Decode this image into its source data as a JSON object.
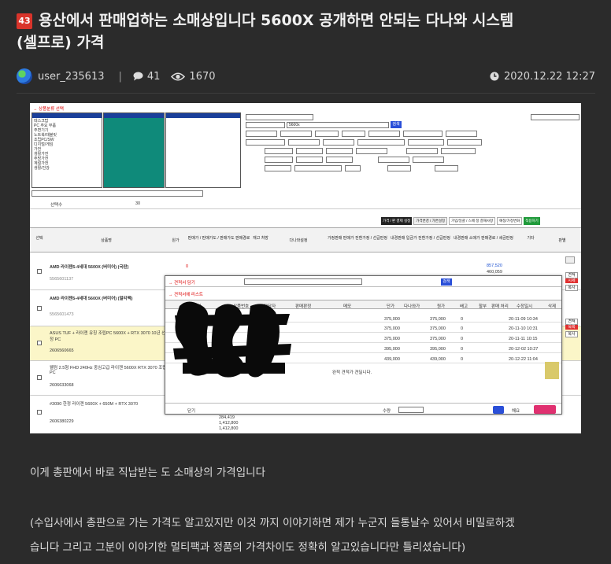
{
  "post": {
    "badge": "43",
    "title_line1": "용산에서 판매업하는 소매상입니다 5600X 공개하면 안되는 다나와 시스템",
    "title_line2": "(셀프로) 가격",
    "author": "user_235613",
    "comments": "41",
    "views": "1670",
    "date": "2020.12.22 12:27"
  },
  "body": {
    "para1": "이게 총판에서 바로 직납받는 도 소매상의 가격입니다",
    "para2": "(수입사에서 총판으로 가는 가격도 알고있지만 이것 까지 이야기하면 제가 누군지 들통날수 있어서 비밀로하겠",
    "para3": "습니다  그리고 그분이 이야기한 멀티팩과 정품의 가격차이도 정확히 알고있습니다만 틀리셨습니다)"
  },
  "screenshot": {
    "category_header": "→ 상품분류 선택",
    "search_btn": "검색",
    "keyword": "5600x",
    "stock_label": "선택수",
    "stock_value": "30",
    "popup_title": "→ 견적서 담기",
    "popup_list_title": "→ 견적서에 리스트",
    "popup_button": "검색",
    "popup_no_more": "완적 견적가 견딜니다.",
    "close_label": "닫기",
    "quantity_label": "수량",
    "save_label": "해요",
    "tabs": [
      "가격 / 판 결제 실정",
      "가격변경 / 가변설정",
      "가입/일괄 / 스페 정 결재사항",
      "예정/가정변화",
      "적용하기"
    ],
    "columns": [
      "선택",
      "상품명",
      "원가",
      "판매가 / 판매가도 / 판매가도 판매경로",
      "재고 처방",
      "다나와설정",
      "가정판매 판매가 전환가정 / 선급판정",
      "내경판매 입금가 전환가정 / 선급판정",
      "내경판매 소매가 판매경로 / 세금판정",
      "기타",
      "판별"
    ],
    "rows": [
      {
        "name": "AMD 라이젠5-4세대 5600X (버미어) (국판)",
        "code": "5565601137",
        "cost": "0"
      },
      {
        "name": "AMD 라이젠5-4세대 5600X (버미어) (멀티팩)",
        "code": "5565601473",
        "cost": "0"
      },
      {
        "name": "ASUS TUF + 라이젠 유칭 조립PC 5600X + RTX 3070 10년 선정 PC",
        "code": "2606560665",
        "cost": "0"
      },
      {
        "name": "웰컴 2.5형 FHD 240Hz 중심고급 라이젠 5600X RTX 3070 조립PC",
        "code": "2606633068",
        "cost": "0"
      },
      {
        "name": "#3090 한정 라이젠 5600X + 650M + RTX 3070",
        "code": "2606380229",
        "cost": "0"
      }
    ],
    "popup_columns": [
      "상품명",
      "상품번호",
      "담당자",
      "판매판정",
      "메모",
      "단가",
      "다나와가",
      "원가",
      "배고",
      "할부",
      "판매 처리",
      "수정일시",
      "삭제"
    ],
    "popup_rows": [
      {
        "price": "375,000",
        "danawa": "375,000",
        "won": "0",
        "date": "20-11-09 10:34"
      },
      {
        "price": "375,000",
        "danawa": "375,000",
        "won": "0",
        "date": "20-11-10 10:31"
      },
      {
        "price": "375,000",
        "danawa": "375,000",
        "won": "0",
        "date": "20-11-11 10:15"
      },
      {
        "price": "395,000",
        "danawa": "395,000",
        "won": "0",
        "date": "20-12-02 10:27"
      },
      {
        "price": "439,000",
        "danawa": "439,000",
        "won": "0",
        "date": "20-12-22 11:04"
      }
    ],
    "price_top": "857,520",
    "price_top2": "460,059",
    "bottom_values": [
      "284,419",
      "1,412,800",
      "1,412,800"
    ],
    "side_buttons": [
      "견적",
      "시세",
      "복사",
      "견적",
      "목록",
      "복사"
    ]
  },
  "colors": {
    "background": "#2b2b2b",
    "badge": "#d9342b",
    "accent_red": "#e03030"
  }
}
